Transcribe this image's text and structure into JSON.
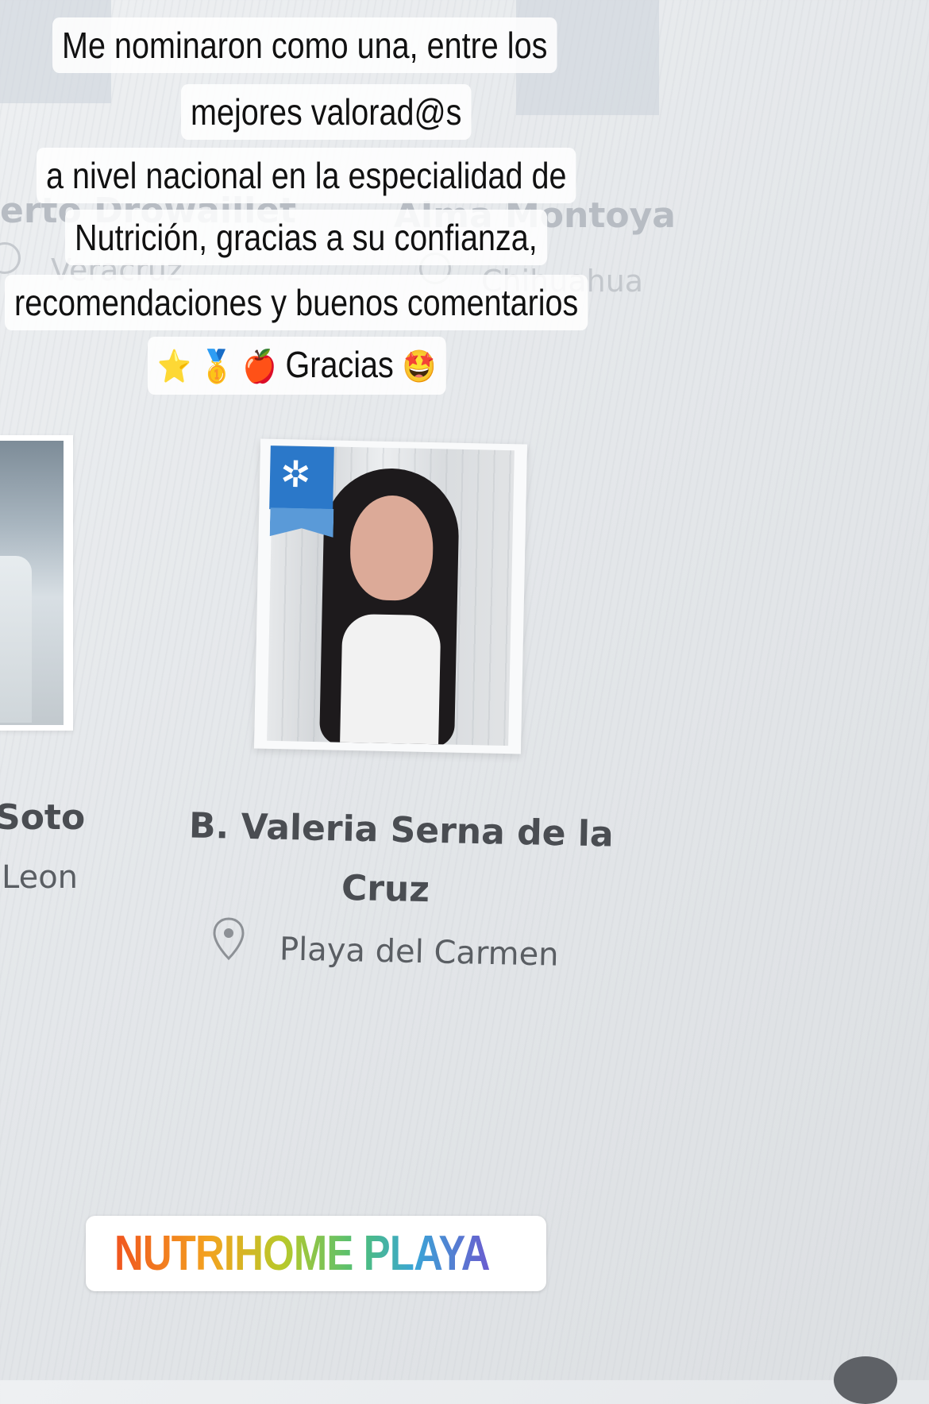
{
  "caption": {
    "line1": "Me nominaron como una, entre los",
    "line2": "mejores valorad@s",
    "line3": "a nivel nacional en la especialidad de",
    "line4": "Nutrición, gracias a su confianza,",
    "line5": "recomendaciones y buenos comentarios",
    "line6_text": "Gracias",
    "emoji_star": "⭐",
    "emoji_medal": "🥇",
    "emoji_apple": "🍎",
    "emoji_starstruck": "🤩"
  },
  "background_cards": {
    "left_name_partial": "erto Drowaillet",
    "left_city": "Veracruz",
    "right_name": "Alma Montoya",
    "right_city": "Chihuahua"
  },
  "left_card": {
    "name_partial": "Soto",
    "city_partial": "Leon"
  },
  "main_card": {
    "name_line1": "B. Valeria Serna de la",
    "name_line2": "Cruz",
    "location": "Playa del Carmen",
    "badge_icon": "✲"
  },
  "location_sticker": {
    "label": "NUTRIHOME PLAYA",
    "pin_icon": "map-pin-icon"
  },
  "colors": {
    "badge_blue": "#2b78c9",
    "pin_red": "#e8462a"
  }
}
